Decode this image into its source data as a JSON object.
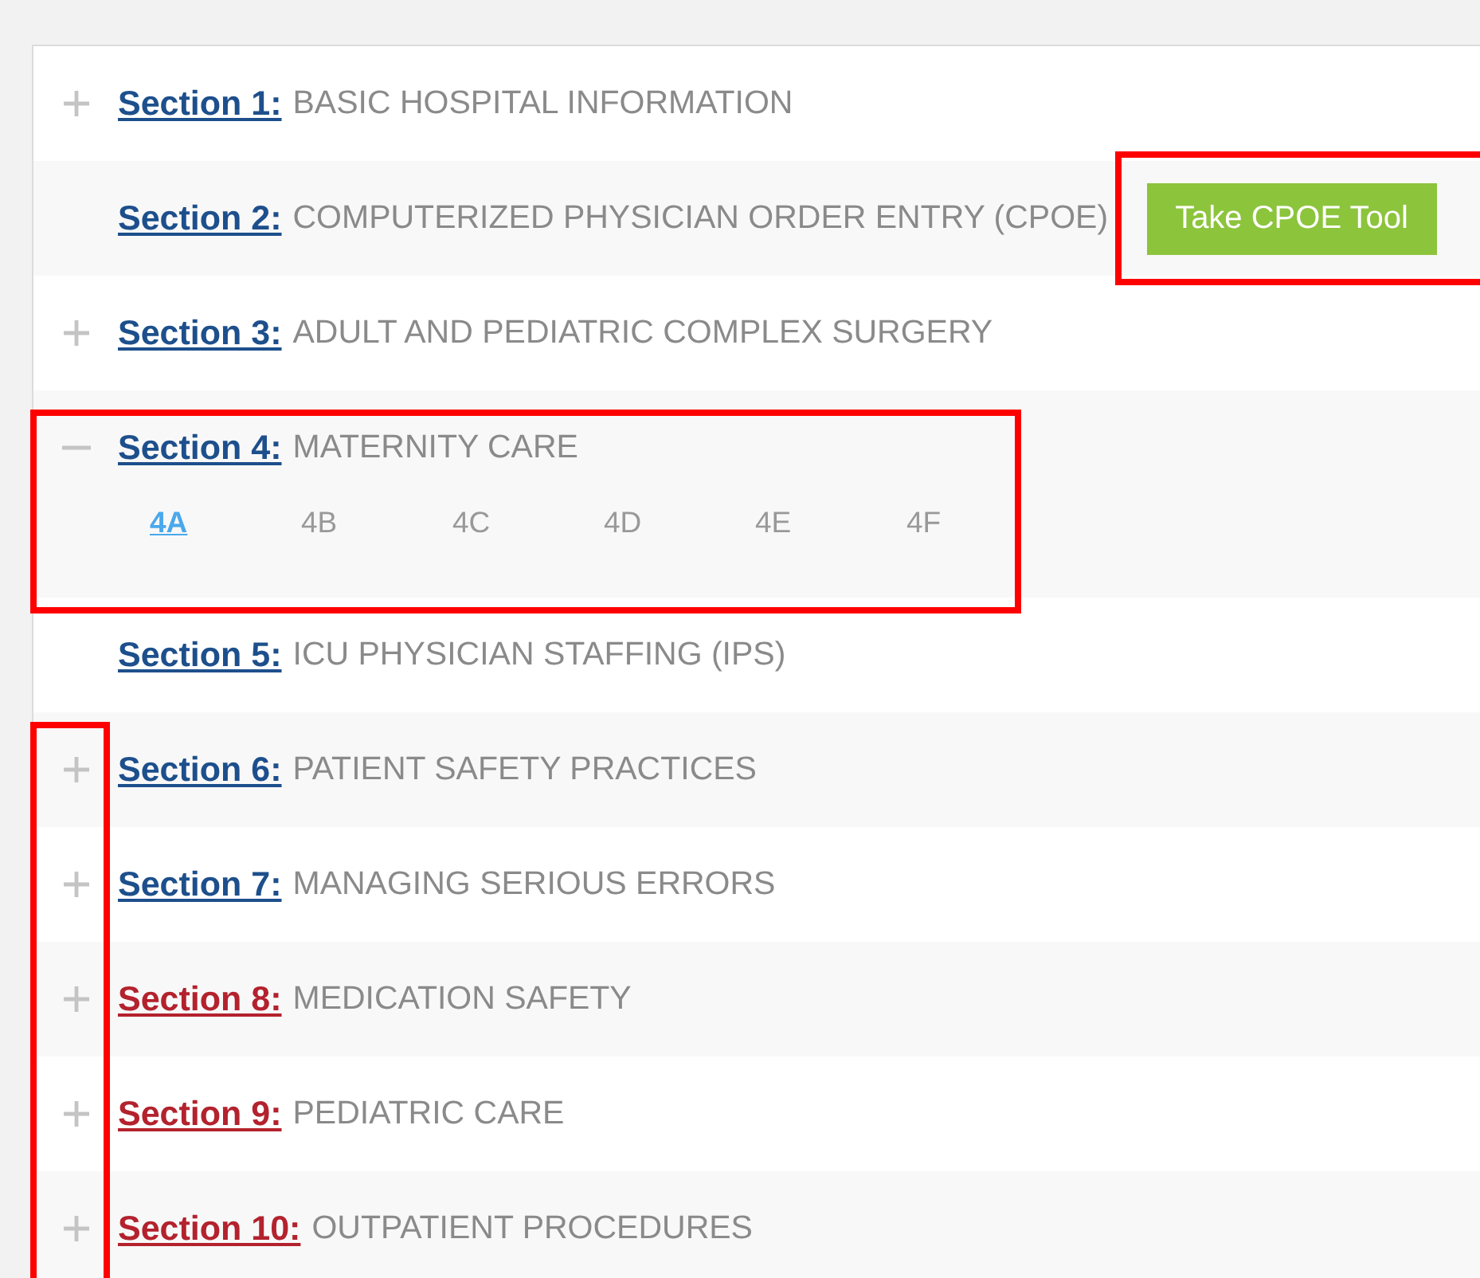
{
  "sections": [
    {
      "label": "Section 1:",
      "title": "BASIC HOSPITAL INFORMATION",
      "color": "#1d4f8c",
      "kind": "expandable",
      "expanded": false
    },
    {
      "label": "Section 2:",
      "title": "COMPUTERIZED PHYSICIAN ORDER ENTRY (CPOE)",
      "color": "#1d4f8c",
      "kind": "plain",
      "button": {
        "label": "Take CPOE Tool",
        "highlighted": true
      }
    },
    {
      "label": "Section 3:",
      "title": "ADULT AND PEDIATRIC COMPLEX SURGERY",
      "color": "#1d4f8c",
      "kind": "expandable",
      "expanded": false
    },
    {
      "label": "Section 4:",
      "title": "MATERNITY CARE",
      "color": "#1d4f8c",
      "kind": "expandable",
      "expanded": true,
      "highlighted": true,
      "subsections": [
        {
          "label": "4A",
          "selected": true
        },
        {
          "label": "4B",
          "selected": false
        },
        {
          "label": "4C",
          "selected": false
        },
        {
          "label": "4D",
          "selected": false
        },
        {
          "label": "4E",
          "selected": false
        },
        {
          "label": "4F",
          "selected": false
        }
      ]
    },
    {
      "label": "Section 5:",
      "title": "ICU PHYSICIAN STAFFING (IPS)",
      "color": "#1d4f8c",
      "kind": "plain"
    },
    {
      "label": "Section 6:",
      "title": "PATIENT SAFETY PRACTICES",
      "color": "#1d4f8c",
      "kind": "expandable",
      "expanded": false,
      "icon_highlighted": true
    },
    {
      "label": "Section 7:",
      "title": "MANAGING SERIOUS ERRORS",
      "color": "#1d4f8c",
      "kind": "expandable",
      "expanded": false,
      "icon_highlighted": true
    },
    {
      "label": "Section 8:",
      "title": "MEDICATION SAFETY",
      "color": "#b3222d",
      "kind": "expandable",
      "expanded": false,
      "icon_highlighted": true
    },
    {
      "label": "Section 9:",
      "title": "PEDIATRIC CARE",
      "color": "#b3222d",
      "kind": "expandable",
      "expanded": false,
      "icon_highlighted": true
    },
    {
      "label": "Section 10:",
      "title": "OUTPATIENT PROCEDURES",
      "color": "#b3222d",
      "kind": "expandable",
      "expanded": false,
      "icon_highlighted": true
    }
  ]
}
